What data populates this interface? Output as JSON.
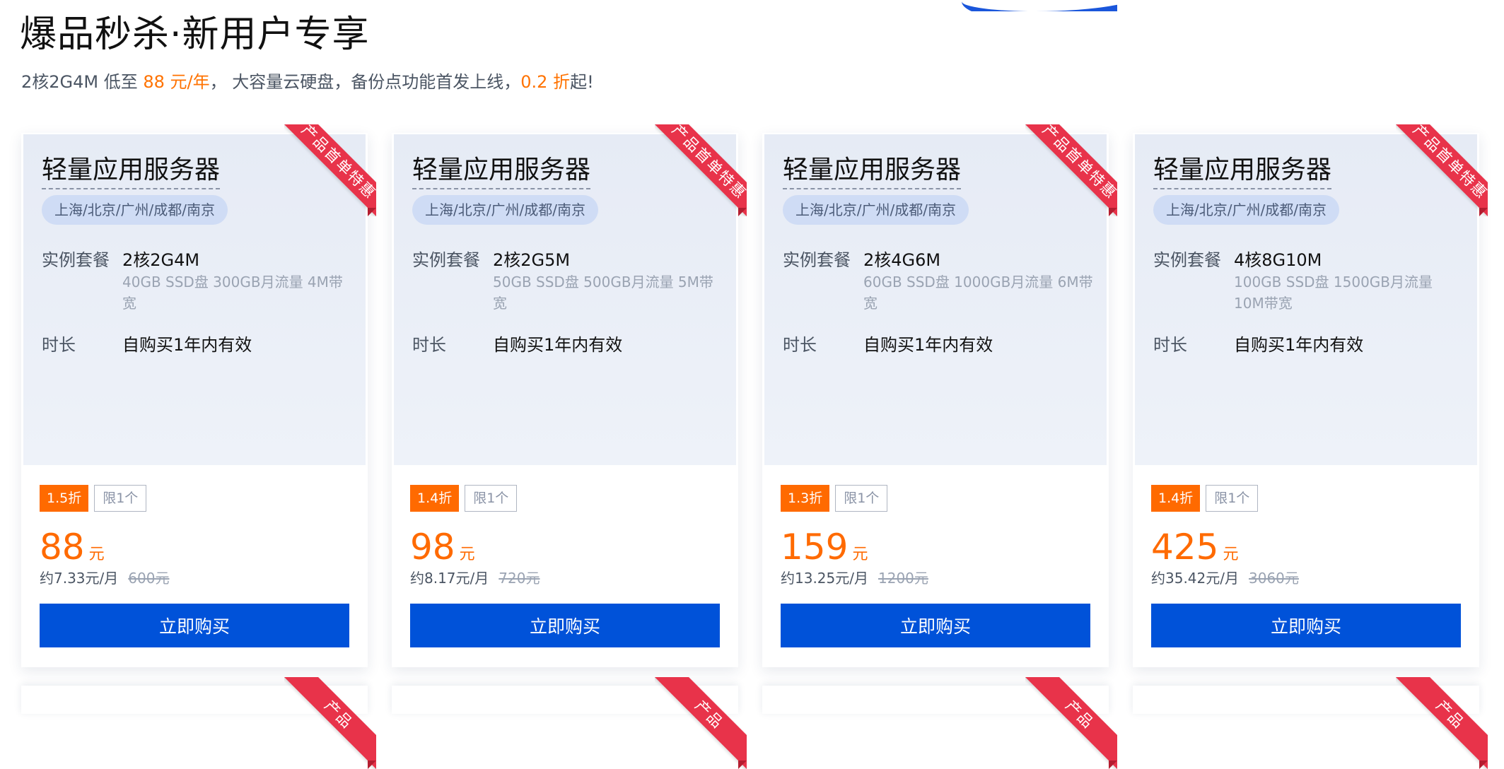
{
  "header": {
    "title": "爆品秒杀·新用户专享",
    "subtitle": {
      "part1": "2核2G4M 低至 ",
      "price": "88 元/年",
      "part2": "， 大容量云硬盘，备份点功能首发上线，",
      "discount": "0.2 折",
      "part3": "起!"
    }
  },
  "colors": {
    "accent_orange": "#ff6a00",
    "button_blue": "#0052d9",
    "ribbon_red": "#e8334a"
  },
  "cards": [
    {
      "ribbon": "产品首单特惠",
      "name": "轻量应用服务器",
      "regions": "上海/北京/广州/成都/南京",
      "plan_label": "实例套餐",
      "plan": "2核2G4M",
      "plan_desc": "40GB SSD盘 300GB月流量 4M带宽",
      "term_label": "时长",
      "term": "自购买1年内有效",
      "discount": "1.5折",
      "limit": "限1个",
      "price": "88",
      "unit": "元",
      "monthly": "约7.33元/月",
      "original": "600元",
      "buy": "立即购买"
    },
    {
      "ribbon": "产品首单特惠",
      "name": "轻量应用服务器",
      "regions": "上海/北京/广州/成都/南京",
      "plan_label": "实例套餐",
      "plan": "2核2G5M",
      "plan_desc": "50GB SSD盘 500GB月流量 5M带宽",
      "term_label": "时长",
      "term": "自购买1年内有效",
      "discount": "1.4折",
      "limit": "限1个",
      "price": "98",
      "unit": "元",
      "monthly": "约8.17元/月",
      "original": "720元",
      "buy": "立即购买"
    },
    {
      "ribbon": "产品首单特惠",
      "name": "轻量应用服务器",
      "regions": "上海/北京/广州/成都/南京",
      "plan_label": "实例套餐",
      "plan": "2核4G6M",
      "plan_desc": "60GB SSD盘 1000GB月流量 6M带宽",
      "term_label": "时长",
      "term": "自购买1年内有效",
      "discount": "1.3折",
      "limit": "限1个",
      "price": "159",
      "unit": "元",
      "monthly": "约13.25元/月",
      "original": "1200元",
      "buy": "立即购买"
    },
    {
      "ribbon": "产品首单特惠",
      "name": "轻量应用服务器",
      "regions": "上海/北京/广州/成都/南京",
      "plan_label": "实例套餐",
      "plan": "4核8G10M",
      "plan_desc": "100GB SSD盘 1500GB月流量 10M带宽",
      "term_label": "时长",
      "term": "自购买1年内有效",
      "discount": "1.4折",
      "limit": "限1个",
      "price": "425",
      "unit": "元",
      "monthly": "约35.42元/月",
      "original": "3060元",
      "buy": "立即购买"
    }
  ],
  "next_row_ribbon": "产品"
}
